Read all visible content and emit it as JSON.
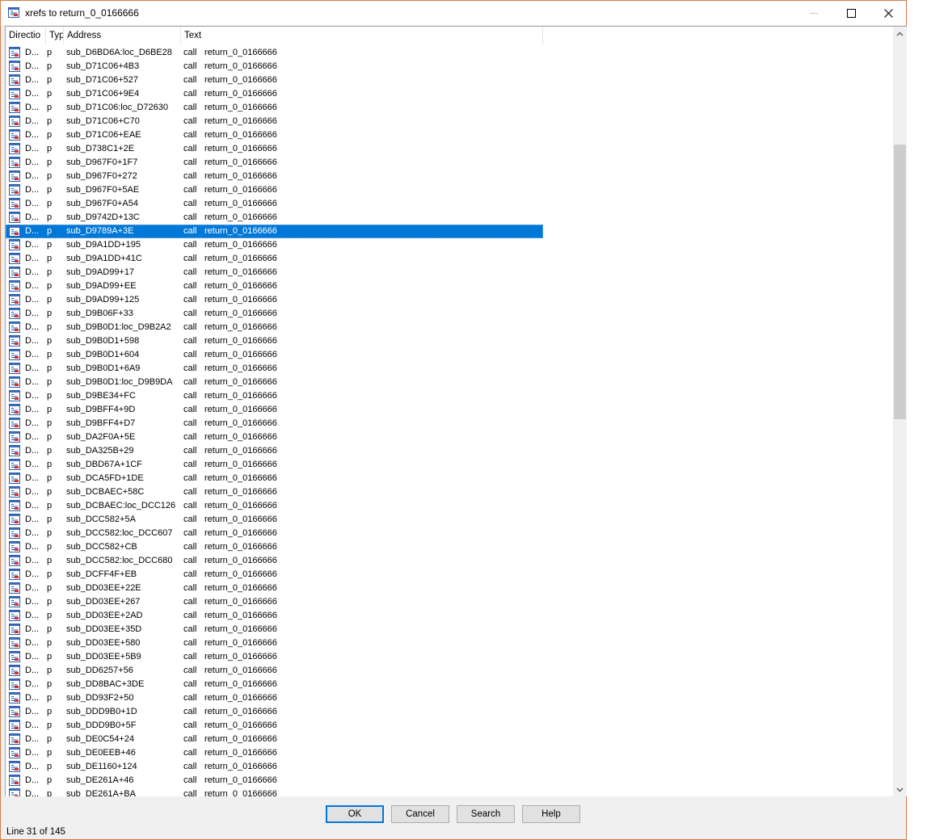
{
  "window": {
    "title": "xrefs to return_0_0166666",
    "icon": "xrefs-window-icon",
    "controls": {
      "minimize": "minimize-icon",
      "maximize": "maximize-icon",
      "close": "close-icon"
    }
  },
  "columns": [
    {
      "label": "Directio"
    },
    {
      "label": "Typ"
    },
    {
      "label": "Address"
    },
    {
      "label": "Text"
    }
  ],
  "selected_index": 13,
  "rows": [
    {
      "dir": "D...",
      "type": "p",
      "address": "sub_D6BD6A:loc_D6BE28",
      "op": "call",
      "target": "return_0_0166666"
    },
    {
      "dir": "D...",
      "type": "p",
      "address": "sub_D71C06+4B3",
      "op": "call",
      "target": "return_0_0166666"
    },
    {
      "dir": "D...",
      "type": "p",
      "address": "sub_D71C06+527",
      "op": "call",
      "target": "return_0_0166666"
    },
    {
      "dir": "D...",
      "type": "p",
      "address": "sub_D71C06+9E4",
      "op": "call",
      "target": "return_0_0166666"
    },
    {
      "dir": "D...",
      "type": "p",
      "address": "sub_D71C06:loc_D72630",
      "op": "call",
      "target": "return_0_0166666"
    },
    {
      "dir": "D...",
      "type": "p",
      "address": "sub_D71C06+C70",
      "op": "call",
      "target": "return_0_0166666"
    },
    {
      "dir": "D...",
      "type": "p",
      "address": "sub_D71C06+EAE",
      "op": "call",
      "target": "return_0_0166666"
    },
    {
      "dir": "D...",
      "type": "p",
      "address": "sub_D738C1+2E",
      "op": "call",
      "target": "return_0_0166666"
    },
    {
      "dir": "D...",
      "type": "p",
      "address": "sub_D967F0+1F7",
      "op": "call",
      "target": "return_0_0166666"
    },
    {
      "dir": "D...",
      "type": "p",
      "address": "sub_D967F0+272",
      "op": "call",
      "target": "return_0_0166666"
    },
    {
      "dir": "D...",
      "type": "p",
      "address": "sub_D967F0+5AE",
      "op": "call",
      "target": "return_0_0166666"
    },
    {
      "dir": "D...",
      "type": "p",
      "address": "sub_D967F0+A54",
      "op": "call",
      "target": "return_0_0166666"
    },
    {
      "dir": "D...",
      "type": "p",
      "address": "sub_D9742D+13C",
      "op": "call",
      "target": "return_0_0166666"
    },
    {
      "dir": "D...",
      "type": "p",
      "address": "sub_D9789A+3E",
      "op": "call",
      "target": "return_0_0166666"
    },
    {
      "dir": "D...",
      "type": "p",
      "address": "sub_D9A1DD+195",
      "op": "call",
      "target": "return_0_0166666"
    },
    {
      "dir": "D...",
      "type": "p",
      "address": "sub_D9A1DD+41C",
      "op": "call",
      "target": "return_0_0166666"
    },
    {
      "dir": "D...",
      "type": "p",
      "address": "sub_D9AD99+17",
      "op": "call",
      "target": "return_0_0166666"
    },
    {
      "dir": "D...",
      "type": "p",
      "address": "sub_D9AD99+EE",
      "op": "call",
      "target": "return_0_0166666"
    },
    {
      "dir": "D...",
      "type": "p",
      "address": "sub_D9AD99+125",
      "op": "call",
      "target": "return_0_0166666"
    },
    {
      "dir": "D...",
      "type": "p",
      "address": "sub_D9B06F+33",
      "op": "call",
      "target": "return_0_0166666"
    },
    {
      "dir": "D...",
      "type": "p",
      "address": "sub_D9B0D1:loc_D9B2A2",
      "op": "call",
      "target": "return_0_0166666"
    },
    {
      "dir": "D...",
      "type": "p",
      "address": "sub_D9B0D1+598",
      "op": "call",
      "target": "return_0_0166666"
    },
    {
      "dir": "D...",
      "type": "p",
      "address": "sub_D9B0D1+604",
      "op": "call",
      "target": "return_0_0166666"
    },
    {
      "dir": "D...",
      "type": "p",
      "address": "sub_D9B0D1+6A9",
      "op": "call",
      "target": "return_0_0166666"
    },
    {
      "dir": "D...",
      "type": "p",
      "address": "sub_D9B0D1:loc_D9B9DA",
      "op": "call",
      "target": "return_0_0166666"
    },
    {
      "dir": "D...",
      "type": "p",
      "address": "sub_D9BE34+FC",
      "op": "call",
      "target": "return_0_0166666"
    },
    {
      "dir": "D...",
      "type": "p",
      "address": "sub_D9BFF4+9D",
      "op": "call",
      "target": "return_0_0166666"
    },
    {
      "dir": "D...",
      "type": "p",
      "address": "sub_D9BFF4+D7",
      "op": "call",
      "target": "return_0_0166666"
    },
    {
      "dir": "D...",
      "type": "p",
      "address": "sub_DA2F0A+5E",
      "op": "call",
      "target": "return_0_0166666"
    },
    {
      "dir": "D...",
      "type": "p",
      "address": "sub_DA325B+29",
      "op": "call",
      "target": "return_0_0166666"
    },
    {
      "dir": "D...",
      "type": "p",
      "address": "sub_DBD67A+1CF",
      "op": "call",
      "target": "return_0_0166666"
    },
    {
      "dir": "D...",
      "type": "p",
      "address": "sub_DCA5FD+1DE",
      "op": "call",
      "target": "return_0_0166666"
    },
    {
      "dir": "D...",
      "type": "p",
      "address": "sub_DCBAEC+58C",
      "op": "call",
      "target": "return_0_0166666"
    },
    {
      "dir": "D...",
      "type": "p",
      "address": "sub_DCBAEC:loc_DCC126",
      "op": "call",
      "target": "return_0_0166666"
    },
    {
      "dir": "D...",
      "type": "p",
      "address": "sub_DCC582+5A",
      "op": "call",
      "target": "return_0_0166666"
    },
    {
      "dir": "D...",
      "type": "p",
      "address": "sub_DCC582:loc_DCC607",
      "op": "call",
      "target": "return_0_0166666"
    },
    {
      "dir": "D...",
      "type": "p",
      "address": "sub_DCC582+CB",
      "op": "call",
      "target": "return_0_0166666"
    },
    {
      "dir": "D...",
      "type": "p",
      "address": "sub_DCC582:loc_DCC680",
      "op": "call",
      "target": "return_0_0166666"
    },
    {
      "dir": "D...",
      "type": "p",
      "address": "sub_DCFF4F+EB",
      "op": "call",
      "target": "return_0_0166666"
    },
    {
      "dir": "D...",
      "type": "p",
      "address": "sub_DD03EE+22E",
      "op": "call",
      "target": "return_0_0166666"
    },
    {
      "dir": "D...",
      "type": "p",
      "address": "sub_DD03EE+267",
      "op": "call",
      "target": "return_0_0166666"
    },
    {
      "dir": "D...",
      "type": "p",
      "address": "sub_DD03EE+2AD",
      "op": "call",
      "target": "return_0_0166666"
    },
    {
      "dir": "D...",
      "type": "p",
      "address": "sub_DD03EE+35D",
      "op": "call",
      "target": "return_0_0166666"
    },
    {
      "dir": "D...",
      "type": "p",
      "address": "sub_DD03EE+580",
      "op": "call",
      "target": "return_0_0166666"
    },
    {
      "dir": "D...",
      "type": "p",
      "address": "sub_DD03EE+5B9",
      "op": "call",
      "target": "return_0_0166666"
    },
    {
      "dir": "D...",
      "type": "p",
      "address": "sub_DD6257+56",
      "op": "call",
      "target": "return_0_0166666"
    },
    {
      "dir": "D...",
      "type": "p",
      "address": "sub_DD8BAC+3DE",
      "op": "call",
      "target": "return_0_0166666"
    },
    {
      "dir": "D...",
      "type": "p",
      "address": "sub_DD93F2+50",
      "op": "call",
      "target": "return_0_0166666"
    },
    {
      "dir": "D...",
      "type": "p",
      "address": "sub_DDD9B0+1D",
      "op": "call",
      "target": "return_0_0166666"
    },
    {
      "dir": "D...",
      "type": "p",
      "address": "sub_DDD9B0+5F",
      "op": "call",
      "target": "return_0_0166666"
    },
    {
      "dir": "D...",
      "type": "p",
      "address": "sub_DE0C54+24",
      "op": "call",
      "target": "return_0_0166666"
    },
    {
      "dir": "D...",
      "type": "p",
      "address": "sub_DE0EEB+46",
      "op": "call",
      "target": "return_0_0166666"
    },
    {
      "dir": "D...",
      "type": "p",
      "address": "sub_DE1160+124",
      "op": "call",
      "target": "return_0_0166666"
    },
    {
      "dir": "D...",
      "type": "p",
      "address": "sub_DE261A+46",
      "op": "call",
      "target": "return_0_0166666"
    },
    {
      "dir": "D...",
      "type": "p",
      "address": "sub_DE261A+BA",
      "op": "call",
      "target": "return_0_0166666"
    }
  ],
  "scrollbar": {
    "position_fraction": 0.14,
    "visible_fraction": 0.37
  },
  "buttons": {
    "ok": "OK",
    "cancel": "Cancel",
    "search": "Search",
    "help": "Help"
  },
  "status": "Line 31 of 145",
  "colors": {
    "selection": "#0078d7",
    "border": "#d77a4a",
    "default_button_border": "#0078d7"
  }
}
